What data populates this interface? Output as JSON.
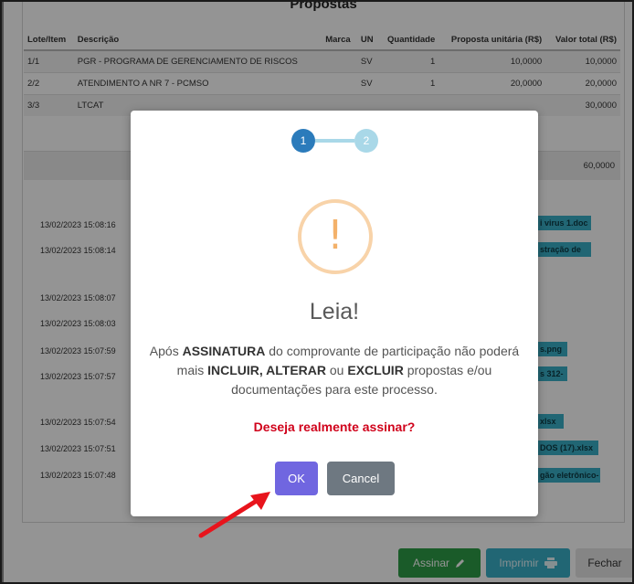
{
  "panel": {
    "title": "Propostas"
  },
  "table": {
    "headers": [
      "Lote/Item",
      "Descrição",
      "Marca",
      "UN",
      "Quantidade",
      "Proposta unitária (R$)",
      "Valor total (R$)"
    ],
    "rows": [
      [
        "1/1",
        "PGR - PROGRAMA DE GERENCIAMENTO DE RISCOS",
        "",
        "SV",
        "1",
        "10,0000",
        "10,0000"
      ],
      [
        "2/2",
        "ATENDIMENTO A NR 7 - PCMSO",
        "",
        "SV",
        "1",
        "20,0000",
        "20,0000"
      ],
      [
        "3/3",
        "LTCAT",
        "",
        "",
        "",
        "",
        "30,0000"
      ]
    ],
    "total": "60,0000"
  },
  "log": {
    "timestamps": [
      "13/02/2023 15:08:16",
      "13/02/2023 15:08:14",
      "13/02/2023 15:08:07",
      "13/02/2023 15:08:03",
      "13/02/2023 15:07:59",
      "13/02/2023 15:07:57",
      "13/02/2023 15:07:54",
      "13/02/2023 15:07:51",
      "13/02/2023 15:07:48"
    ],
    "files": [
      "i virus 1.doc",
      "stração de",
      "s.png",
      "s 312-",
      "xlsx",
      "DOS (17).xlsx",
      "gão eletrônico-"
    ]
  },
  "footer": {
    "assinar": "Assinar",
    "imprimir": "Imprimir",
    "fechar": "Fechar"
  },
  "modal": {
    "step1": "1",
    "step2": "2",
    "warn_symbol": "!",
    "title": "Leia!",
    "body": {
      "p1": "Após ",
      "b1": "ASSINATURA",
      "p2": " do comprovante de participação não poderá mais ",
      "b2": "INCLUIR, ALTERAR",
      "p3": " ou ",
      "b3": "EXCLUIR",
      "p4": " propostas e/ou documentações para este processo."
    },
    "question": "Deseja realmente assinar?",
    "ok": "OK",
    "cancel": "Cancel"
  },
  "colors": {
    "confirm": "#7066e0",
    "cancel": "#6e7881",
    "warning": "#f3b16a",
    "question": "#d0021b",
    "assinar": "#2e9e48",
    "imprimir": "#3ab0c8",
    "arrow": "#e8141c"
  },
  "icons": [
    "pencil-icon",
    "printer-icon",
    "exclamation-icon",
    "arrow-pointer-icon"
  ]
}
